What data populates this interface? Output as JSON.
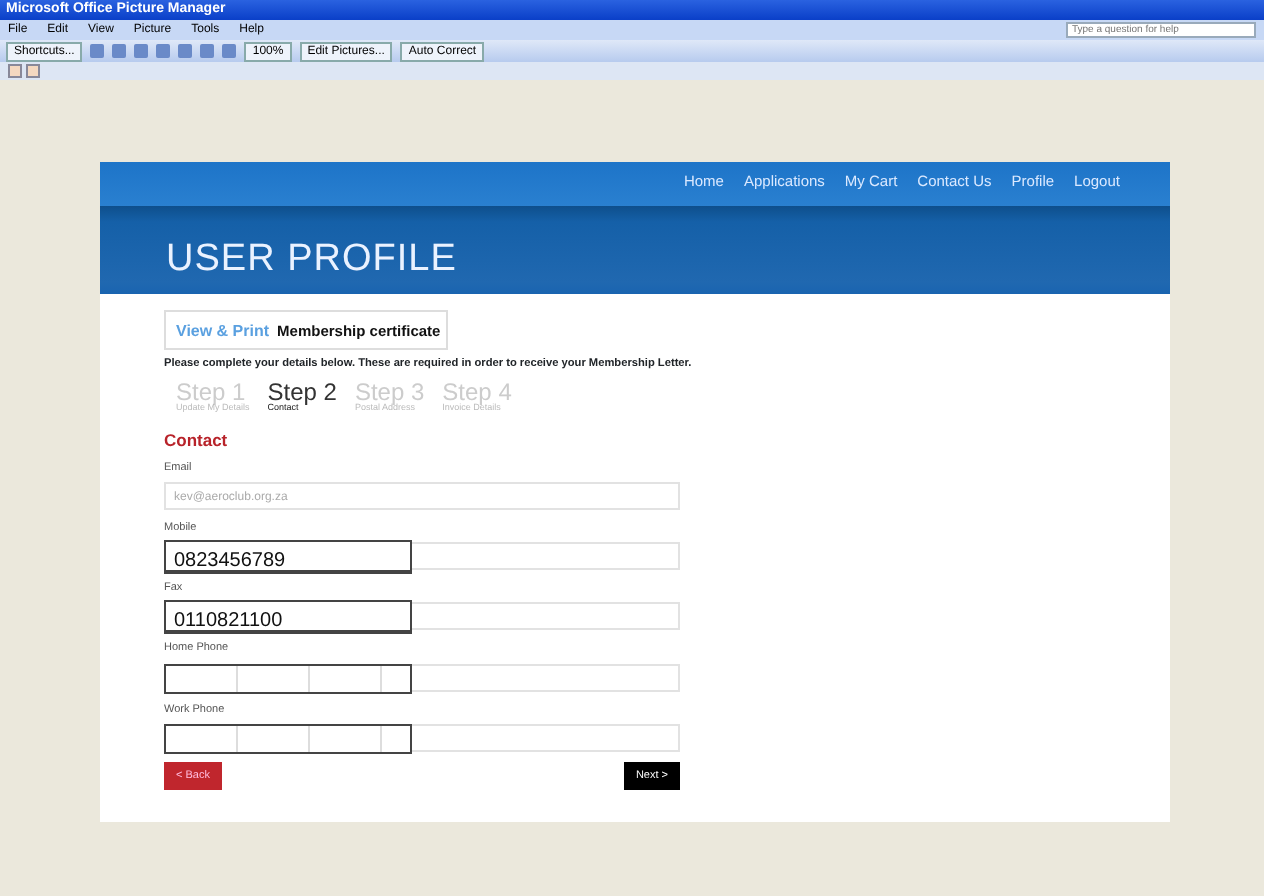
{
  "window": {
    "title": "Microsoft Office Picture Manager"
  },
  "menu": [
    "File",
    "Edit",
    "View",
    "Picture",
    "Tools",
    "Help"
  ],
  "help_search": {
    "placeholder": "Type a question for help"
  },
  "toolbar": [
    {
      "kind": "text",
      "label": "Shortcuts..."
    },
    {
      "kind": "icons"
    },
    {
      "kind": "zoom",
      "label": "100%"
    },
    {
      "kind": "text",
      "label": "Edit Pictures..."
    },
    {
      "kind": "text",
      "label": "Auto Correct"
    }
  ],
  "site": {
    "nav": [
      "Home",
      "Applications",
      "My Cart",
      "Contact Us",
      "Profile",
      "Logout"
    ],
    "title": "USER PROFILE",
    "tab": {
      "label": "View & Print",
      "text": "Membership certificate"
    },
    "instructions": "Please complete your details below. These are required in order to receive your Membership Letter.",
    "steps": [
      {
        "title": "Step 1",
        "subtitle": "Update My Details",
        "selected": false
      },
      {
        "title": "Step 2",
        "subtitle": "Contact",
        "selected": true
      },
      {
        "title": "Step 3",
        "subtitle": "Postal Address",
        "selected": false
      },
      {
        "title": "Step 4",
        "subtitle": "Invoice Details",
        "selected": false
      }
    ],
    "section": "Contact",
    "fields": [
      {
        "label": "Email",
        "kind": "plain",
        "value": "kev@aeroclub.org.za"
      },
      {
        "label": "Mobile",
        "kind": "overlay",
        "value": "0823456789"
      },
      {
        "label": "Fax",
        "kind": "overlay",
        "value": "0110821100"
      },
      {
        "label": "Home Phone",
        "kind": "segmented"
      },
      {
        "label": "Work Phone",
        "kind": "segmented"
      }
    ],
    "back": "< Back",
    "next": "Next >"
  }
}
